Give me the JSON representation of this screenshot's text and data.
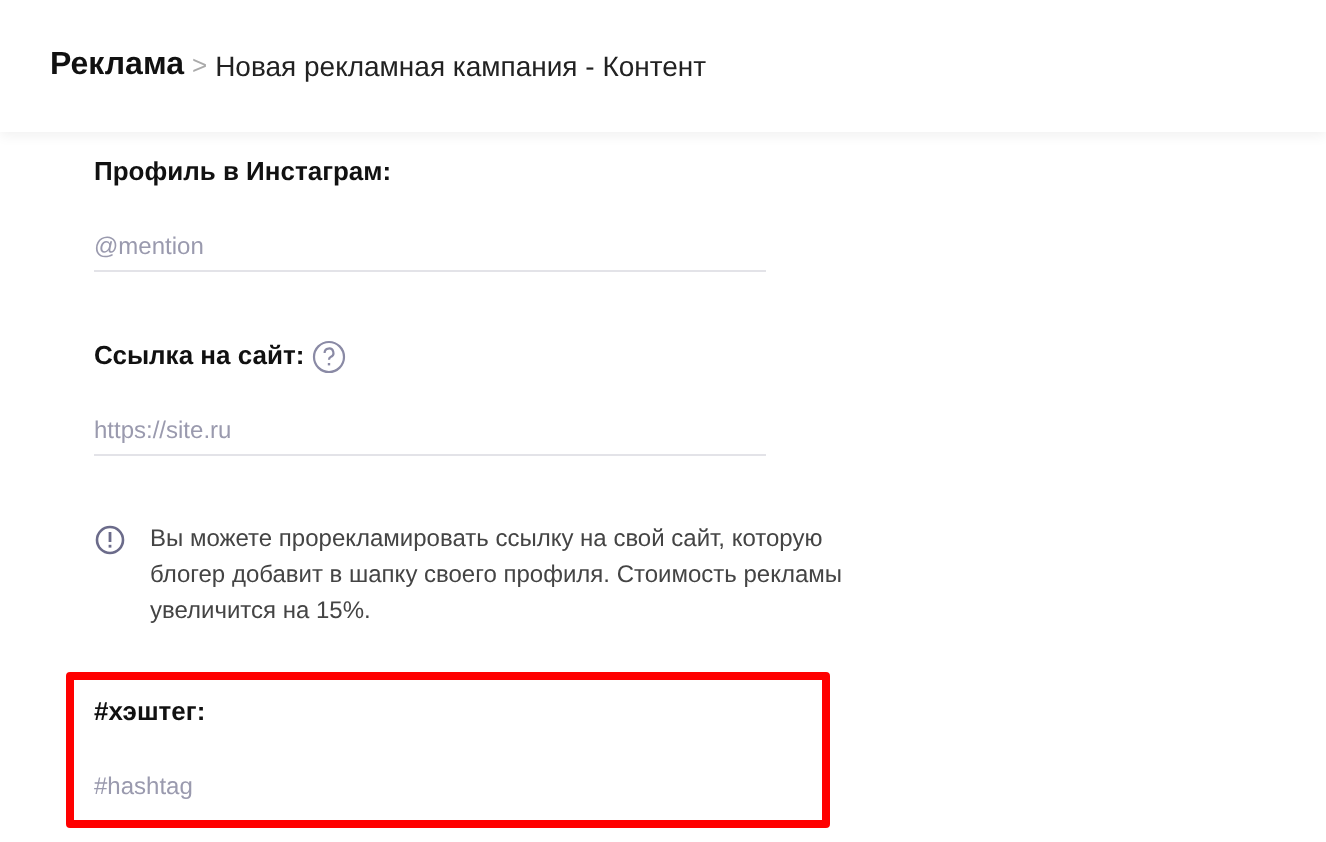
{
  "breadcrumb": {
    "root": "Реклама",
    "separator": ">",
    "current": "Новая рекламная кампания - Контент"
  },
  "fields": [
    {
      "kind": "input",
      "label": "Профиль в Инстаграм:",
      "placeholder": "@mention",
      "help": false,
      "highlighted": false
    },
    {
      "kind": "input",
      "label": "Ссылка на сайт:",
      "placeholder": "https://site.ru",
      "help": true,
      "highlighted": false
    },
    {
      "kind": "note",
      "text": "Вы можете прорекламировать ссылку на свой сайт, которую блогер добавит в шапку своего профиля. Стоимость рекламы увеличится на 15%."
    },
    {
      "kind": "input",
      "label": "#хэштег:",
      "placeholder": "#hashtag",
      "help": false,
      "highlighted": true
    }
  ]
}
